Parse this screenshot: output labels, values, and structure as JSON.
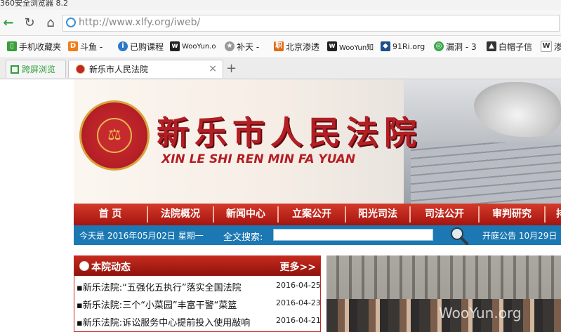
{
  "window": {
    "title": "360安全浏览器 8.2"
  },
  "nav": {
    "url": "http://www.xlfy.org/iweb/"
  },
  "bookmarks": [
    {
      "label": "手机收藏夹",
      "icon": "phone-icon"
    },
    {
      "label": "斗鱼 -",
      "icon": "douyu-icon"
    },
    {
      "label": "已购课程",
      "icon": "course-icon"
    },
    {
      "label": "WooYun.o",
      "icon": "wooyun-icon"
    },
    {
      "label": "补天 -",
      "icon": "butian-icon"
    },
    {
      "label": "北京渗透",
      "icon": "bookmark-icon"
    },
    {
      "label": "WooYun知",
      "icon": "wooyun-icon"
    },
    {
      "label": "91Ri.org",
      "icon": "shield-icon"
    },
    {
      "label": "漏洞 - 3",
      "icon": "bug-icon"
    },
    {
      "label": "白帽子信",
      "icon": "whitehat-icon"
    },
    {
      "label": "渗",
      "icon": "w-icon"
    }
  ],
  "tabs": [
    {
      "label": "跨屏浏览"
    },
    {
      "label": "新乐市人民法院",
      "close": "×"
    }
  ],
  "newtab": "+",
  "site": {
    "title_cn": "新乐市人民法院",
    "title_en": "XIN LE SHI REN MIN FA YUAN",
    "menu": [
      "首 页",
      "法院概况",
      "新闻中心",
      "立案公开",
      "阳光司法",
      "司法公开",
      "审判研究",
      "排"
    ],
    "date": "今天是 2016年05月02日 星期一",
    "search_label": "全文搜索:",
    "notice": "开庭公告  10月29日",
    "news_panel": {
      "title": "本院动态",
      "more": "更多>>",
      "items": [
        {
          "title": "▪新乐法院:“五强化五执行”落实全国法院",
          "date": "2016-04-25"
        },
        {
          "title": "▪新乐法院:三个“小菜园”丰富干警“菜篮",
          "date": "2016-04-23"
        },
        {
          "title": "▪新乐法院:诉讼服务中心提前投入使用敲响",
          "date": "2016-04-21"
        }
      ]
    },
    "photo_watermark": "WooYun.org"
  },
  "colors": {
    "court_red": "#b31e24",
    "nav_red": "#c52b1f",
    "info_blue": "#1b78b3"
  }
}
